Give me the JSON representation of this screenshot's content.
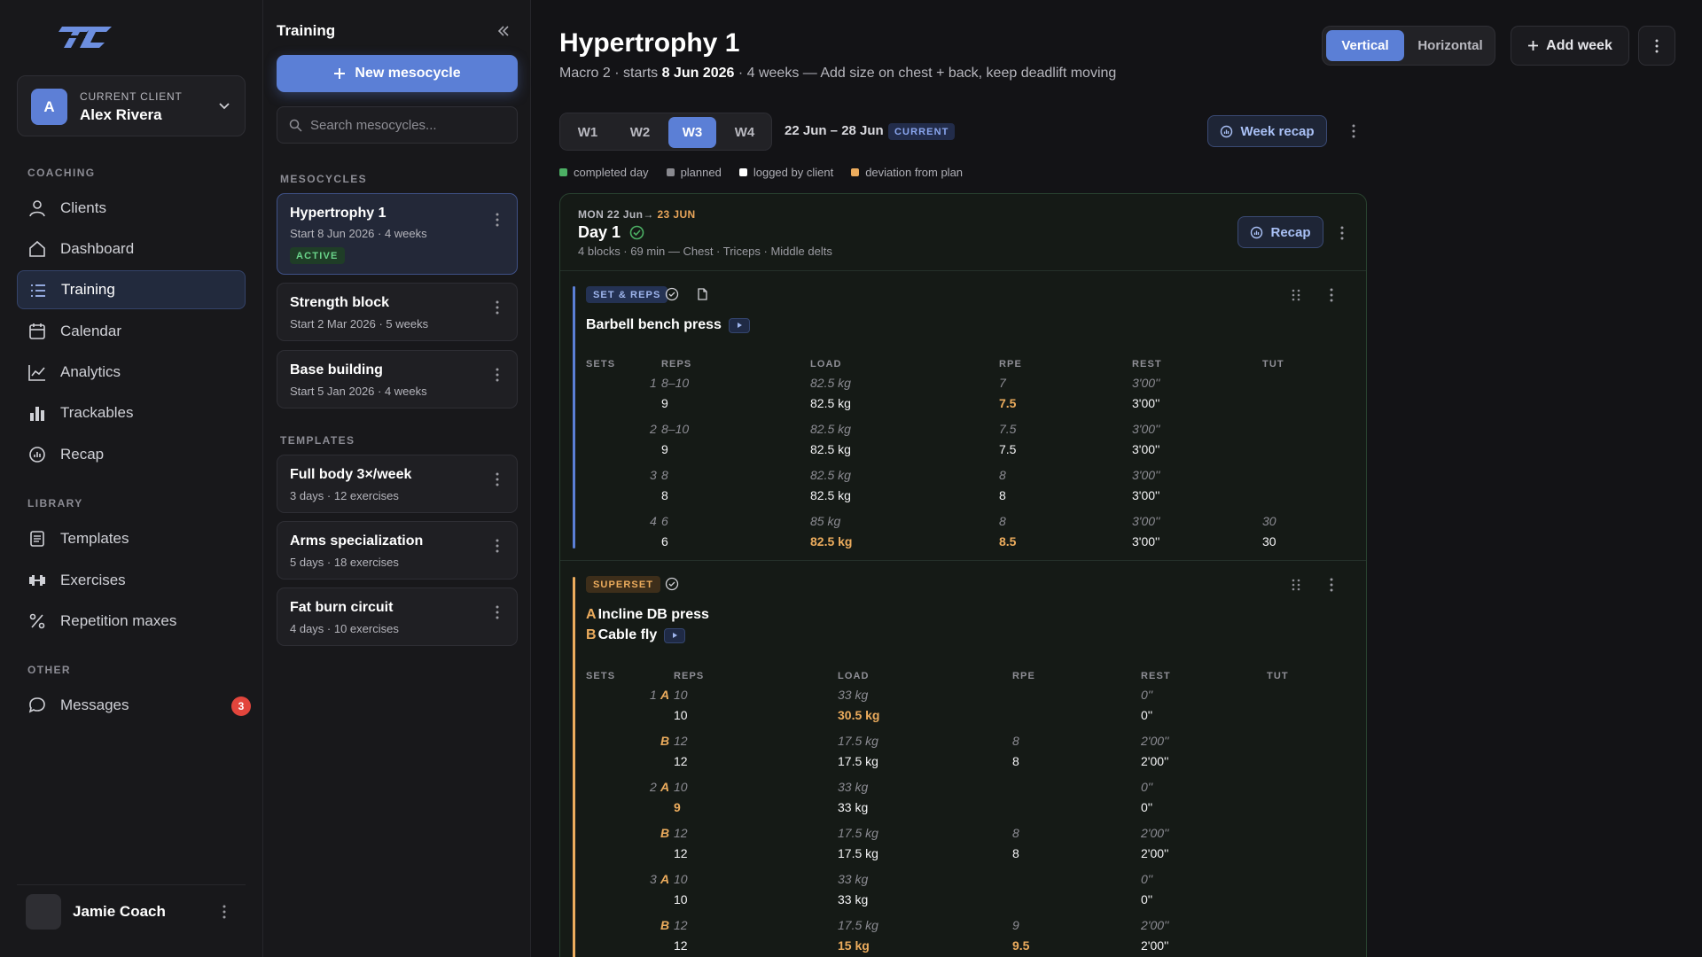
{
  "colors": {
    "accent": "#5b7fd6",
    "completed": "#4caf64",
    "planned": "#8a8a90",
    "logged": "#ffffff",
    "deviation": "#ecac5d",
    "danger": "#e2453c"
  },
  "sidebar": {
    "logo_icon": "brand-logo",
    "client_caption": "CURRENT CLIENT",
    "client_initial": "A",
    "client_name": "Alex Rivera",
    "sections": {
      "coaching": "COACHING",
      "library": "LIBRARY",
      "other": "OTHER"
    },
    "nav": {
      "clients": "Clients",
      "dashboard": "Dashboard",
      "training": "Training",
      "calendar": "Calendar",
      "analytics": "Analytics",
      "trackables": "Trackables",
      "recap": "Recap",
      "templates": "Templates",
      "exercises": "Exercises",
      "repetition_maxes": "Repetition maxes",
      "messages": "Messages"
    },
    "messages_badge": "3",
    "user_name": "Jamie Coach"
  },
  "mesocycle_panel": {
    "title": "Training",
    "new_button": "New mesocycle",
    "search_placeholder": "Search mesocycles...",
    "mesocycles_label": "MESOCYCLES",
    "templates_label": "TEMPLATES",
    "mesocycles": [
      {
        "name": "Hypertrophy 1",
        "sub": "Start 8 Jun 2026 · 4 weeks",
        "badge": "ACTIVE"
      },
      {
        "name": "Strength block",
        "sub": "Start 2 Mar 2026 · 5 weeks"
      },
      {
        "name": "Base building",
        "sub": "Start 5 Jan 2026 · 4 weeks"
      }
    ],
    "templates": [
      {
        "name": "Full body 3×/week",
        "sub": "3 days · 12 exercises"
      },
      {
        "name": "Arms specialization",
        "sub": "5 days · 18 exercises"
      },
      {
        "name": "Fat burn circuit",
        "sub": "4 days · 10 exercises"
      }
    ]
  },
  "main": {
    "title": "Hypertrophy 1",
    "sub_prefix": "Macro 2 · starts ",
    "sub_date": "8 Jun 2026",
    "sub_suffix": " · 4 weeks — Add size on chest + back, keep deadlift moving",
    "view_toggle": {
      "vertical": "Vertical",
      "horizontal": "Horizontal",
      "selected": "Vertical"
    },
    "add_week": "Add week",
    "weeks": [
      "W1",
      "W2",
      "W3",
      "W4"
    ],
    "selected_week": "W3",
    "week_range": "22 Jun – 28 Jun",
    "current_badge": "CURRENT",
    "week_recap": "Week recap",
    "legend": [
      "completed day",
      "planned",
      "logged by client",
      "deviation from plan"
    ],
    "day": {
      "date_from": "MON 22 Jun→ ",
      "date_to": "23 JUN",
      "name": "Day 1",
      "meta": "4 blocks · 69 min — Chest · Triceps · Middle delts",
      "recap": "Recap"
    },
    "columns": {
      "sets": "SETS",
      "reps": "REPS",
      "load": "LOAD",
      "rpe": "RPE",
      "rest": "REST",
      "tut": "TUT"
    },
    "block1": {
      "tag": "SET & REPS",
      "exercise": "Barbell bench press",
      "sets": [
        {
          "n": "1",
          "reps_plan": "8–10",
          "reps": "9",
          "load_plan": "82.5 kg",
          "load": "82.5 kg",
          "rpe_plan": "7",
          "rpe": "7.5",
          "rest_plan": "3'00''",
          "rest": "3'00''",
          "tut_plan": "",
          "tut": ""
        },
        {
          "n": "2",
          "reps_plan": "8–10",
          "reps": "9",
          "load_plan": "82.5 kg",
          "load": "82.5 kg",
          "rpe_plan": "7.5",
          "rpe": "7.5",
          "rest_plan": "3'00''",
          "rest": "3'00''",
          "tut_plan": "",
          "tut": ""
        },
        {
          "n": "3",
          "reps_plan": "8",
          "reps": "8",
          "load_plan": "82.5 kg",
          "load": "82.5 kg",
          "rpe_plan": "8",
          "rpe": "8",
          "rest_plan": "3'00''",
          "rest": "3'00''",
          "tut_plan": "",
          "tut": ""
        },
        {
          "n": "4",
          "reps_plan": "6",
          "reps": "6",
          "load_plan": "85 kg",
          "load": "82.5 kg",
          "rpe_plan": "8",
          "rpe": "8.5",
          "rest_plan": "3'00''",
          "rest": "3'00''",
          "tut_plan": "30",
          "tut": "30"
        }
      ]
    },
    "block2": {
      "tag": "SUPERSET",
      "exercise_a_letter": "A",
      "exercise_a": "Incline DB press",
      "exercise_b_letter": "B",
      "exercise_b": "Cable fly",
      "rows": [
        {
          "n": "1",
          "l": "A",
          "reps_plan": "10",
          "reps": "10",
          "load_plan": "33 kg",
          "load": "30.5 kg",
          "rpe_plan": "",
          "rpe": "",
          "rest_plan": "0''",
          "rest": "0''"
        },
        {
          "n": "",
          "l": "B",
          "reps_plan": "12",
          "reps": "12",
          "load_plan": "17.5 kg",
          "load": "17.5 kg",
          "rpe_plan": "8",
          "rpe": "8",
          "rest_plan": "2'00''",
          "rest": "2'00''"
        },
        {
          "n": "2",
          "l": "A",
          "reps_plan": "10",
          "reps": "9",
          "load_plan": "33 kg",
          "load": "33 kg",
          "rpe_plan": "",
          "rpe": "",
          "rest_plan": "0''",
          "rest": "0''"
        },
        {
          "n": "",
          "l": "B",
          "reps_plan": "12",
          "reps": "12",
          "load_plan": "17.5 kg",
          "load": "17.5 kg",
          "rpe_plan": "8",
          "rpe": "8",
          "rest_plan": "2'00''",
          "rest": "2'00''"
        },
        {
          "n": "3",
          "l": "A",
          "reps_plan": "10",
          "reps": "10",
          "load_plan": "33 kg",
          "load": "33 kg",
          "rpe_plan": "",
          "rpe": "",
          "rest_plan": "0''",
          "rest": "0''"
        },
        {
          "n": "",
          "l": "B",
          "reps_plan": "12",
          "reps": "12",
          "load_plan": "17.5 kg",
          "load": "15 kg",
          "rpe_plan": "9",
          "rpe": "9.5",
          "rest_plan": "2'00''",
          "rest": "2'00''"
        }
      ]
    }
  }
}
